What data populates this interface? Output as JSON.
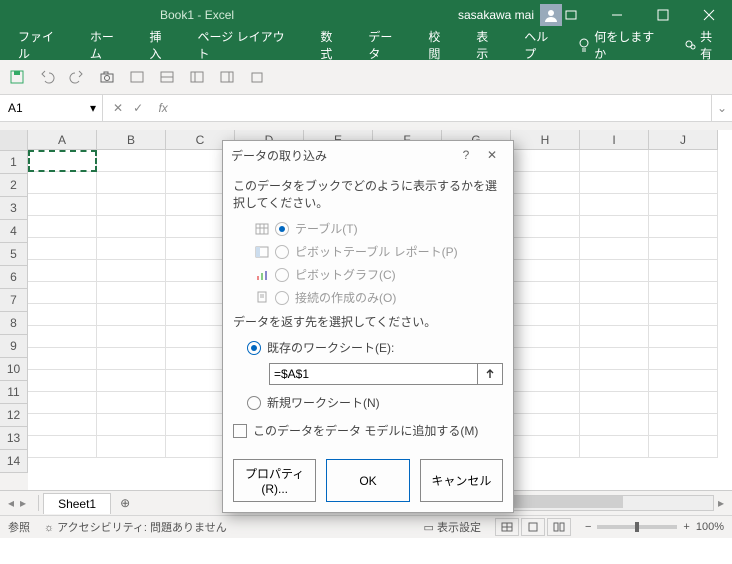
{
  "titlebar": {
    "title": "Book1 - Excel",
    "user": "sasakawa mai"
  },
  "ribbon": {
    "tabs": [
      "ファイル",
      "ホーム",
      "挿入",
      "ページ レイアウト",
      "数式",
      "データ",
      "校閲",
      "表示",
      "ヘルプ"
    ],
    "tell_me": "何をしますか",
    "share": "共有"
  },
  "formula": {
    "name_box": "A1",
    "fx_label": "fx"
  },
  "columns": [
    "A",
    "B",
    "C",
    "D",
    "E",
    "F",
    "G",
    "H",
    "I",
    "J"
  ],
  "rows": [
    "1",
    "2",
    "3",
    "4",
    "5",
    "6",
    "7",
    "8",
    "9",
    "10",
    "11",
    "12",
    "13",
    "14"
  ],
  "sheet_tabs": {
    "active": "Sheet1"
  },
  "statusbar": {
    "mode": "参照",
    "accessibility": "アクセシビリティ: 問題ありません",
    "display_settings": "表示設定",
    "zoom": "100%"
  },
  "dialog": {
    "title": "データの取り込み",
    "msg_display": "このデータをブックでどのように表示するかを選択してください。",
    "opt_table": "テーブル(T)",
    "opt_pivot": "ピボットテーブル レポート(P)",
    "opt_pivotchart": "ピボットグラフ(C)",
    "opt_conn_only": "接続の作成のみ(O)",
    "msg_dest": "データを返す先を選択してください。",
    "opt_existing": "既存のワークシート(E):",
    "ref_value": "=$A$1",
    "opt_new": "新規ワークシート(N)",
    "chk_model": "このデータをデータ モデルに追加する(M)",
    "btn_props": "プロパティ(R)...",
    "btn_ok": "OK",
    "btn_cancel": "キャンセル"
  }
}
